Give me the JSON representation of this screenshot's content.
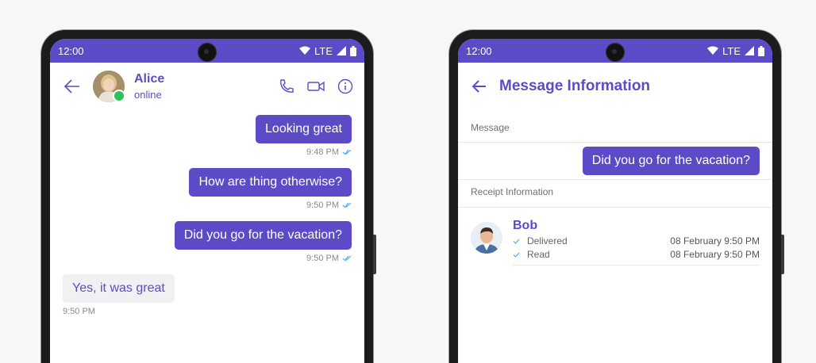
{
  "left_phone": {
    "status": {
      "time": "12:00",
      "network": "LTE"
    },
    "header": {
      "contact_name": "Alice",
      "contact_status": "online"
    },
    "messages": [
      {
        "direction": "out",
        "text": "Looking great",
        "time": "9:48 PM"
      },
      {
        "direction": "out",
        "text": "How are thing otherwise?",
        "time": "9:50 PM"
      },
      {
        "direction": "out",
        "text": "Did you go for the vacation?",
        "time": "9:50 PM"
      },
      {
        "direction": "in",
        "text": "Yes, it was great",
        "time": "9:50 PM"
      }
    ]
  },
  "right_phone": {
    "status": {
      "time": "12:00",
      "network": "LTE"
    },
    "header": {
      "title": "Message Information"
    },
    "message_section_label": "Message",
    "message_text": "Did you go for the vacation?",
    "receipt_section_label": "Receipt Information",
    "receipt": {
      "name": "Bob",
      "delivered_label": "Delivered",
      "delivered_time": "08 February 9:50 PM",
      "read_label": "Read",
      "read_time": "08 February 9:50 PM"
    }
  },
  "colors": {
    "accent": "#5c4bc7",
    "online": "#2ec05a",
    "read_tick": "#3fa9f5"
  },
  "icons": [
    "back-arrow-icon",
    "phone-icon",
    "video-icon",
    "info-icon",
    "wifi-icon",
    "signal-icon",
    "battery-icon",
    "double-check-icon"
  ]
}
